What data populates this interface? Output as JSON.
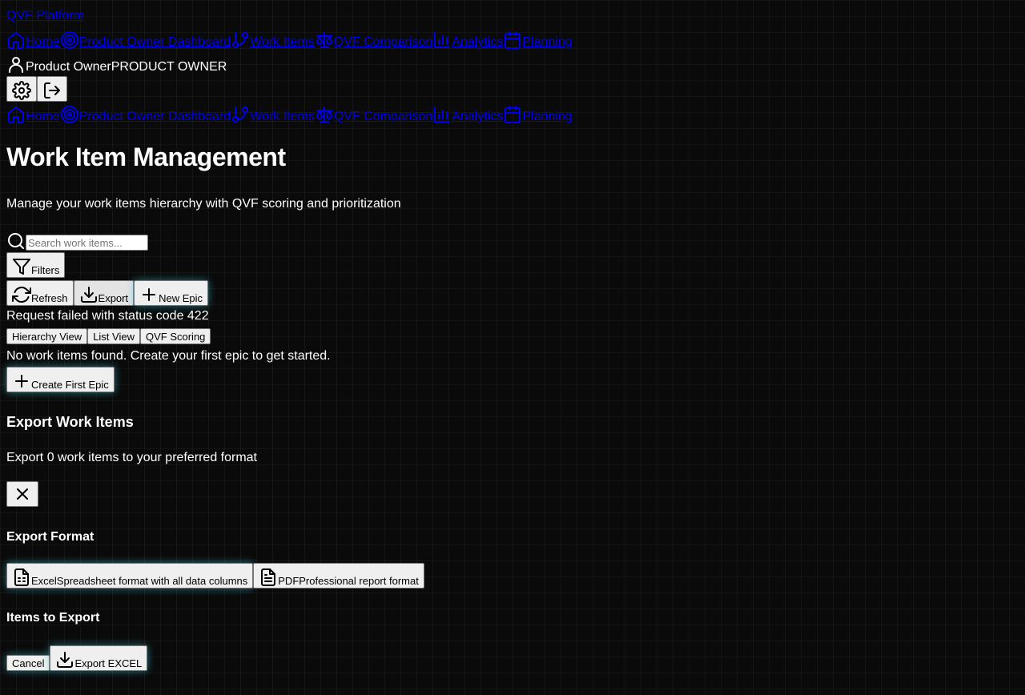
{
  "brand": "QVF Platform",
  "nav": [
    {
      "label": "Home",
      "icon": "home-icon"
    },
    {
      "label": "Product Owner Dashboard",
      "icon": "target-icon"
    },
    {
      "label": "Work Items",
      "icon": "git-branch-icon"
    },
    {
      "label": "QVF Comparison",
      "icon": "scale-icon"
    },
    {
      "label": "Analytics",
      "icon": "bar-chart-icon"
    },
    {
      "label": "Planning",
      "icon": "calendar-icon"
    }
  ],
  "user": {
    "name": "Product Owner",
    "role": "PRODUCT OWNER"
  },
  "page": {
    "title": "Work Item Management",
    "subtitle": "Manage your work items hierarchy with QVF scoring and prioritization"
  },
  "search": {
    "placeholder": "Search work items...",
    "value": ""
  },
  "toolbar": {
    "filters": "Filters",
    "refresh": "Refresh",
    "export": "Export",
    "new_epic": "New Epic"
  },
  "error": "Request failed with status code 422",
  "views": [
    "Hierarchy View",
    "List View",
    "QVF Scoring"
  ],
  "empty": {
    "message": "No work items found. Create your first epic to get started.",
    "button": "Create First Epic"
  },
  "export_dialog": {
    "title": "Export Work Items",
    "description": "Export 0 work items to your preferred format",
    "format_heading": "Export Format",
    "formats": [
      {
        "name": "Excel",
        "description": "Spreadsheet format with all data columns"
      },
      {
        "name": "PDF",
        "description": "Professional report format"
      }
    ],
    "items_heading": "Items to Export",
    "cancel": "Cancel",
    "confirm": "Export EXCEL"
  },
  "colors": {
    "background": "#0a0a0a",
    "link": "#0000ee",
    "glow": "#40c8dc"
  }
}
